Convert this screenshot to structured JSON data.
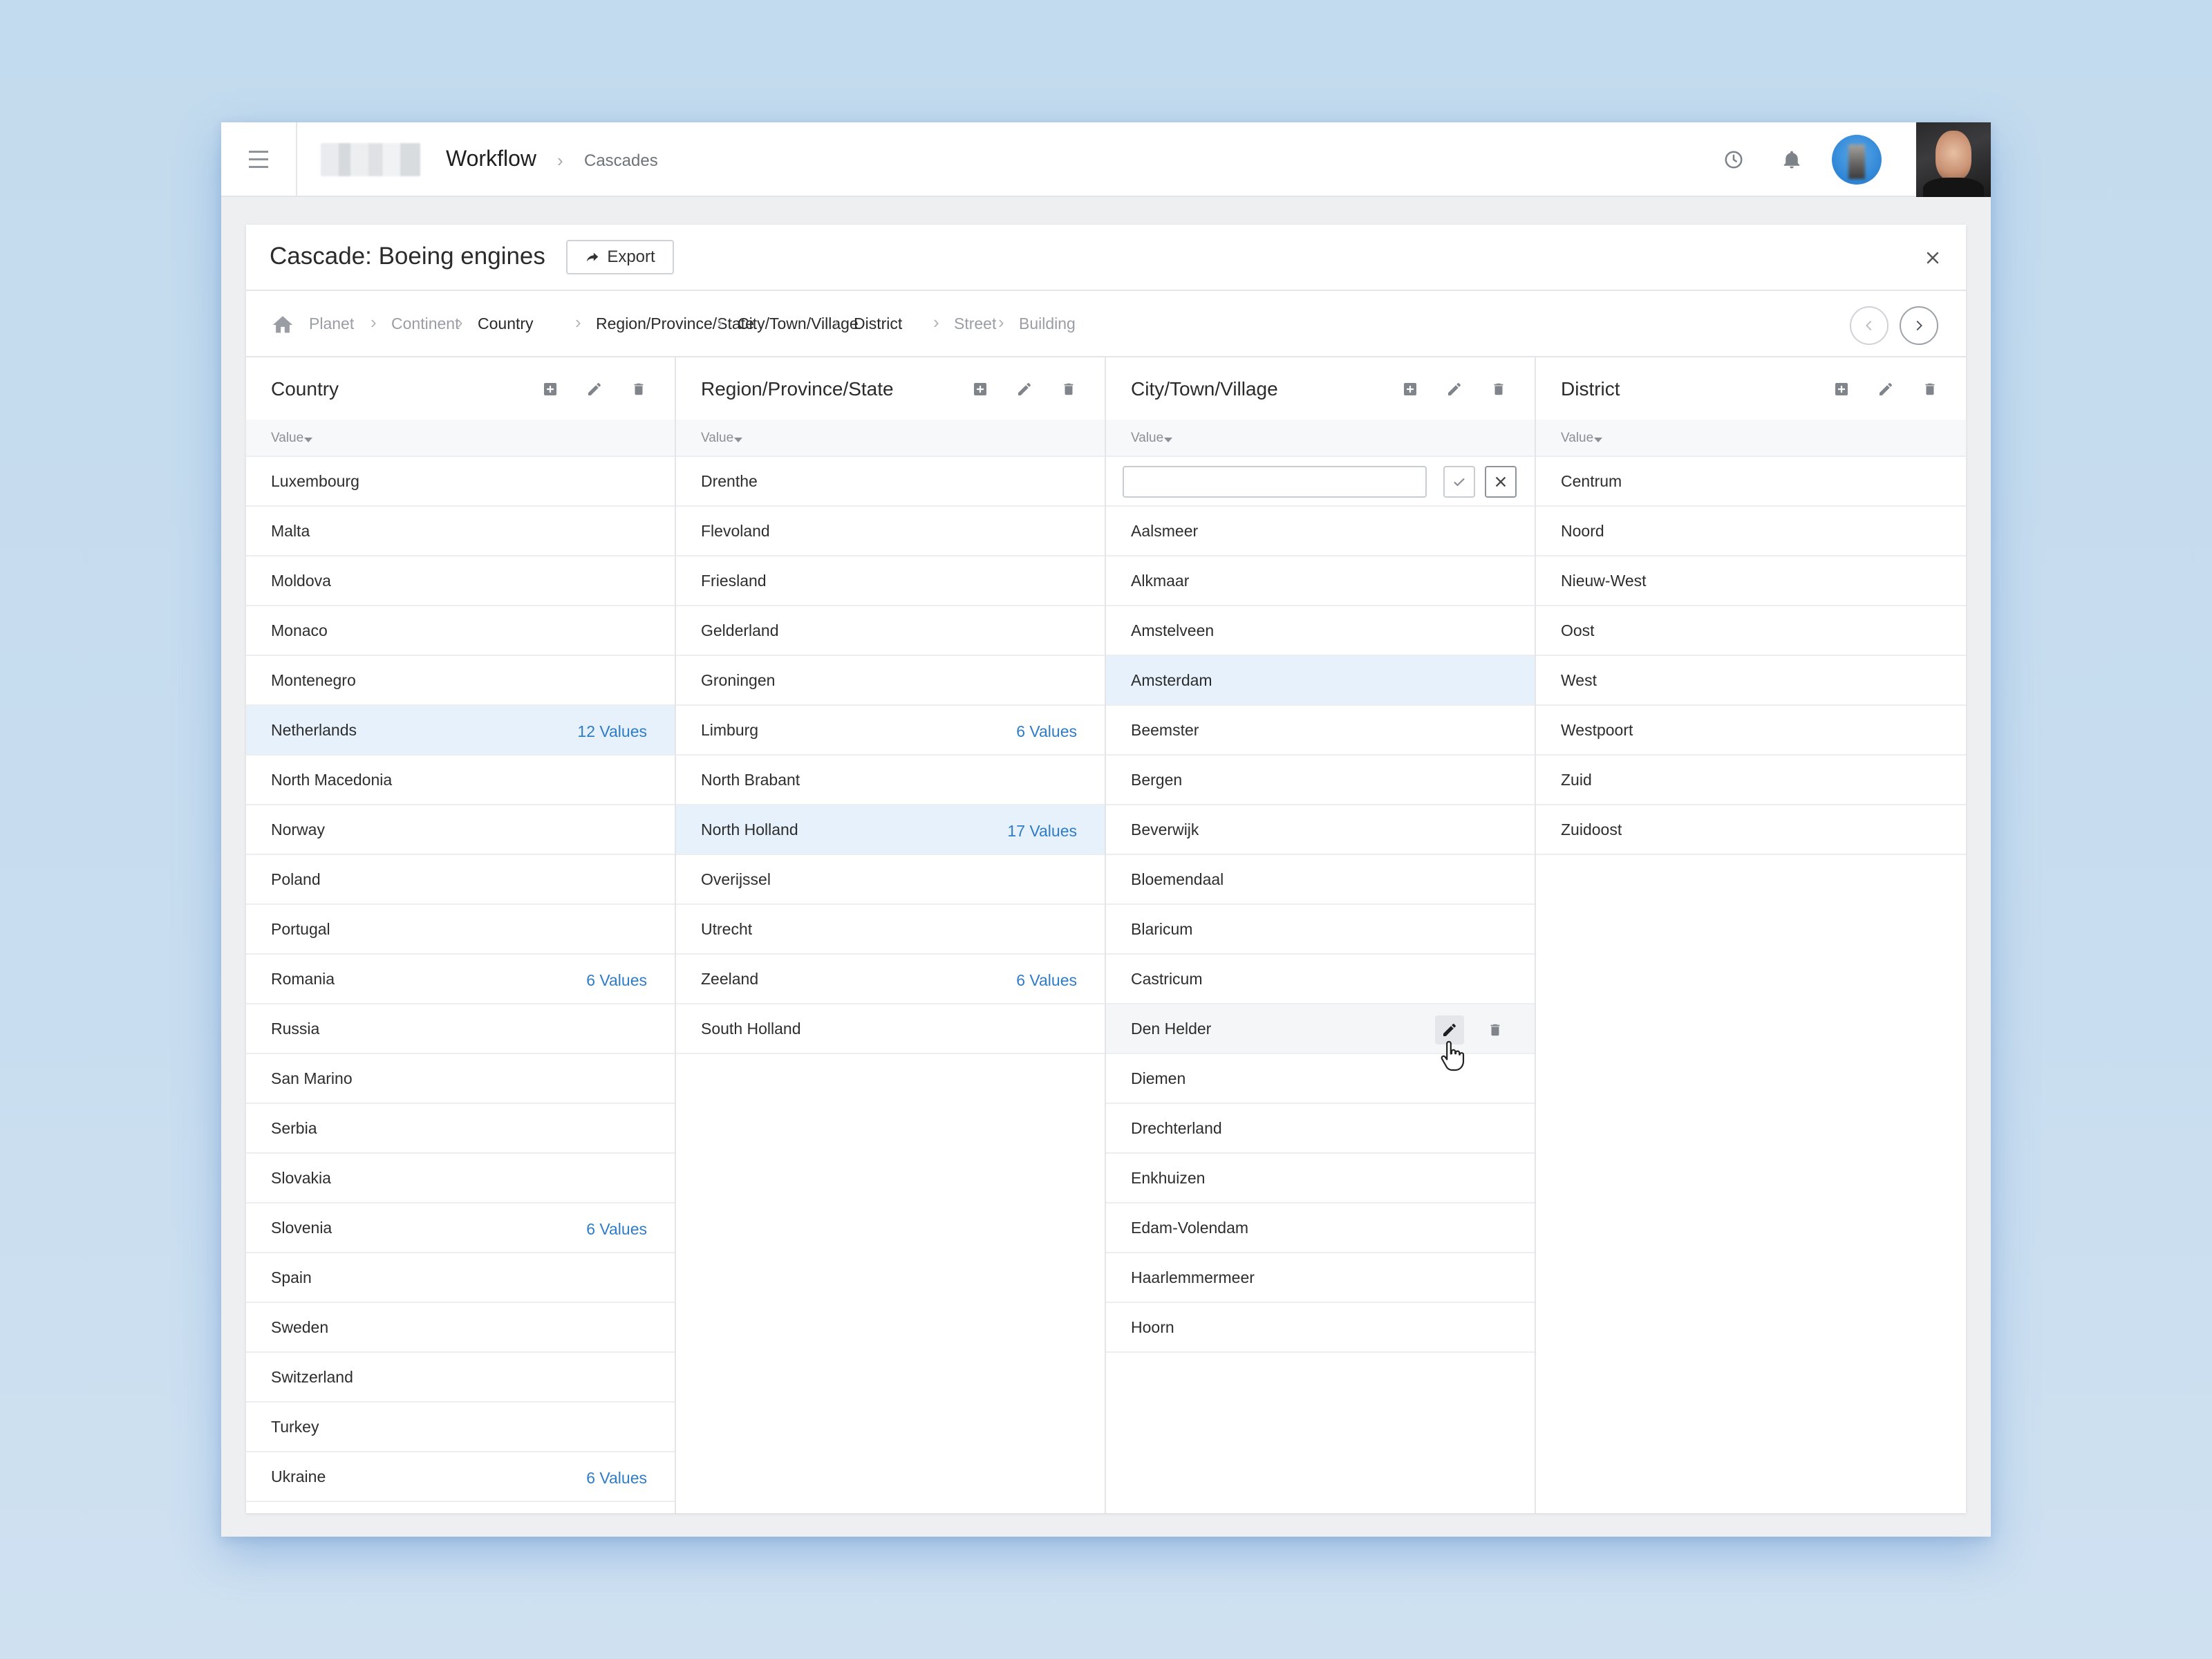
{
  "app": {
    "title": "Workflow",
    "section": "Cascades"
  },
  "dialog": {
    "title": "Cascade: Boeing engines",
    "export_label": "Export"
  },
  "breadcrumb": [
    {
      "label": "Planet",
      "active": false
    },
    {
      "label": "Continent",
      "active": false
    },
    {
      "label": "Country",
      "active": true
    },
    {
      "label": "Region/Province/State",
      "active": true
    },
    {
      "label": "City/Town/Village",
      "active": true
    },
    {
      "label": "District",
      "active": true
    },
    {
      "label": "Street",
      "active": false
    },
    {
      "label": "Building",
      "active": false
    }
  ],
  "column_subheader": "Value",
  "columns": {
    "country": {
      "title": "Country",
      "rows": [
        {
          "label": "Luxembourg"
        },
        {
          "label": "Malta"
        },
        {
          "label": "Moldova"
        },
        {
          "label": "Monaco"
        },
        {
          "label": "Montenegro"
        },
        {
          "label": "Netherlands",
          "count": "12 Values",
          "selected": true
        },
        {
          "label": "North Macedonia"
        },
        {
          "label": "Norway"
        },
        {
          "label": "Poland"
        },
        {
          "label": "Portugal"
        },
        {
          "label": "Romania",
          "count": "6 Values"
        },
        {
          "label": "Russia"
        },
        {
          "label": "San Marino"
        },
        {
          "label": "Serbia"
        },
        {
          "label": "Slovakia"
        },
        {
          "label": "Slovenia",
          "count": "6 Values"
        },
        {
          "label": "Spain"
        },
        {
          "label": "Sweden"
        },
        {
          "label": "Switzerland"
        },
        {
          "label": "Turkey"
        },
        {
          "label": "Ukraine",
          "count": "6 Values"
        }
      ]
    },
    "region": {
      "title": "Region/Province/State",
      "rows": [
        {
          "label": "Drenthe"
        },
        {
          "label": "Flevoland"
        },
        {
          "label": "Friesland"
        },
        {
          "label": "Gelderland"
        },
        {
          "label": "Groningen"
        },
        {
          "label": "Limburg",
          "count": "6 Values"
        },
        {
          "label": "North Brabant"
        },
        {
          "label": "North Holland",
          "count": "17 Values",
          "selected": true
        },
        {
          "label": "Overijssel"
        },
        {
          "label": "Utrecht"
        },
        {
          "label": "Zeeland",
          "count": "6 Values"
        },
        {
          "label": "South Holland"
        }
      ]
    },
    "city": {
      "title": "City/Town/Village",
      "new_value": "",
      "rows": [
        {
          "label": "Aalsmeer"
        },
        {
          "label": "Alkmaar"
        },
        {
          "label": "Amstelveen"
        },
        {
          "label": "Amsterdam",
          "selected": true
        },
        {
          "label": "Beemster"
        },
        {
          "label": "Bergen"
        },
        {
          "label": "Beverwijk"
        },
        {
          "label": "Bloemendaal"
        },
        {
          "label": "Blaricum"
        },
        {
          "label": "Castricum"
        },
        {
          "label": "Den Helder",
          "hover": true
        },
        {
          "label": "Diemen"
        },
        {
          "label": "Drechterland"
        },
        {
          "label": "Enkhuizen"
        },
        {
          "label": "Edam-Volendam"
        },
        {
          "label": "Haarlemmermeer"
        },
        {
          "label": "Hoorn"
        }
      ]
    },
    "district": {
      "title": "District",
      "rows": [
        {
          "label": "Centrum"
        },
        {
          "label": "Noord"
        },
        {
          "label": "Nieuw-West"
        },
        {
          "label": "Oost"
        },
        {
          "label": "West"
        },
        {
          "label": "Westpoort"
        },
        {
          "label": "Zuid"
        },
        {
          "label": "Zuidoost"
        }
      ]
    }
  },
  "colors": {
    "accent": "#2f7cc6",
    "selected_row": "#e6f1fc",
    "background": "#c3dbee"
  },
  "icons": {
    "menu": "hamburger-icon",
    "history": "clock-icon",
    "notifications": "bell-icon",
    "export": "share-arrow-icon",
    "close": "close-icon",
    "home": "home-icon",
    "add": "add-box-icon",
    "edit": "pencil-icon",
    "delete": "trash-icon",
    "confirm": "check-icon",
    "cancel": "x-icon"
  }
}
